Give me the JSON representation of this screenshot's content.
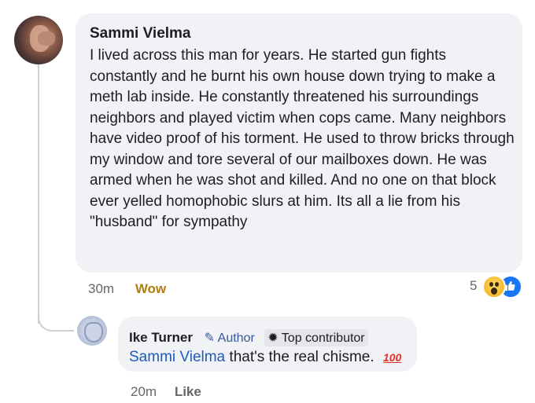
{
  "comment": {
    "author": "Sammi Vielma",
    "text": "I lived across this man for years. He started gun fights constantly and he burnt his own house down trying to make a meth lab inside. He constantly threatened his surroundings neighbors and played victim when cops came. Many neighbors have video proof of his torment. He used to throw bricks through my window and tore several of our mailboxes down. He was armed when he was shot and killed. And no one on that block ever yelled homophobic slurs at him. Its all a lie from his \"husband\" for sympathy",
    "time": "30m",
    "reaction_label": "Wow",
    "reaction_count": "5",
    "reaction_icons": [
      "wow-icon",
      "like-icon"
    ]
  },
  "reply": {
    "author": "Ike Turner",
    "badge_author": "Author",
    "badge_top": "Top contributor",
    "mention": "Sammi Vielma",
    "text": "that's the real chisme.",
    "emoji": "100",
    "time": "20m",
    "like_label": "Like"
  }
}
